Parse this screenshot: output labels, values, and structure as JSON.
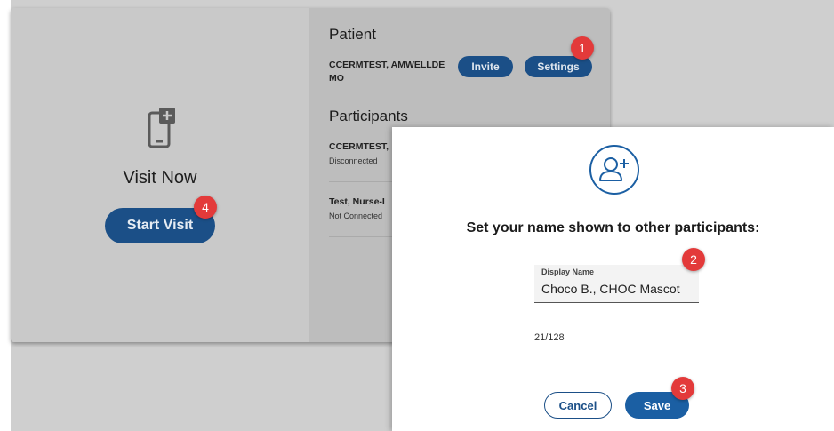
{
  "visit": {
    "title": "Visit Now",
    "start_button": "Start Visit",
    "icon": "mobile-add-icon"
  },
  "patient": {
    "section_title": "Patient",
    "name": "CCERMTEST, AMWELLDE MO",
    "invite_button": "Invite",
    "settings_button": "Settings"
  },
  "participants": {
    "section_title": "Participants",
    "items": [
      {
        "name": "CCERMTEST,",
        "status": "Disconnected"
      },
      {
        "name": "Test, Nurse-I",
        "status": "Not Connected"
      }
    ]
  },
  "dialog": {
    "icon": "add-user-icon",
    "heading": "Set your name shown to other participants:",
    "field_label": "Display Name",
    "field_value": "Choco B., CHOC Mascot",
    "counter": "21/128",
    "cancel_button": "Cancel",
    "save_button": "Save"
  },
  "badges": [
    "1",
    "2",
    "3",
    "4"
  ],
  "colors": {
    "primary": "#1b4f87",
    "save": "#1b5fa3",
    "badge": "#e33a3a",
    "overlay": "#c9c9c9"
  }
}
